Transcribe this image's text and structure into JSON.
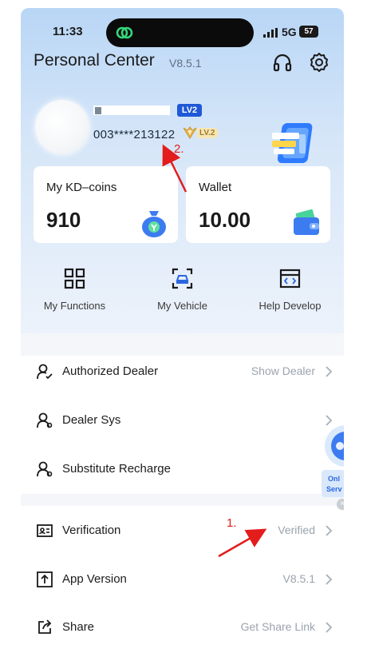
{
  "status_bar": {
    "time": "11:33",
    "network": "5G",
    "battery": "57"
  },
  "header": {
    "title": "Personal Center",
    "version": "V8.5.1",
    "icons": [
      "headset-icon",
      "settings-gear-icon"
    ]
  },
  "profile": {
    "user_id": "003****213122",
    "badge_level": "LV2",
    "vip_level": "LV.2"
  },
  "cards": [
    {
      "title": "My KD–coins",
      "value": "910",
      "icon": "coin-bag-icon"
    },
    {
      "title": "Wallet",
      "value": "10.00",
      "icon": "wallet-icon"
    }
  ],
  "functions": [
    {
      "label": "My Functions",
      "icon": "grid-icon"
    },
    {
      "label": "My Vehicle",
      "icon": "vehicle-scan-icon"
    },
    {
      "label": "Help Develop",
      "icon": "code-window-icon"
    }
  ],
  "menu_group_1": [
    {
      "label": "Authorized Dealer",
      "value": "Show Dealer",
      "icon": "user-check-icon"
    },
    {
      "label": "Dealer Sys",
      "value": "",
      "icon": "user-icon"
    },
    {
      "label": "Substitute Recharge",
      "value": "",
      "icon": "user-icon"
    }
  ],
  "menu_group_2": [
    {
      "label": "Verification",
      "value": "Verified",
      "icon": "id-card-icon"
    },
    {
      "label": "App Version",
      "value": "V8.5.1",
      "icon": "upload-box-icon"
    },
    {
      "label": "Share",
      "value": "Get Share Link",
      "icon": "share-icon"
    }
  ],
  "floating_service": {
    "text_1": "Onl",
    "text_2": "Serv"
  },
  "annotations": {
    "label_1": "1.",
    "label_2": "2."
  },
  "colors": {
    "accent_blue": "#1f59d6",
    "annotation_red": "#e31c1c",
    "muted_text": "#9aa3ad",
    "hero_top": "#b9d6f6"
  }
}
